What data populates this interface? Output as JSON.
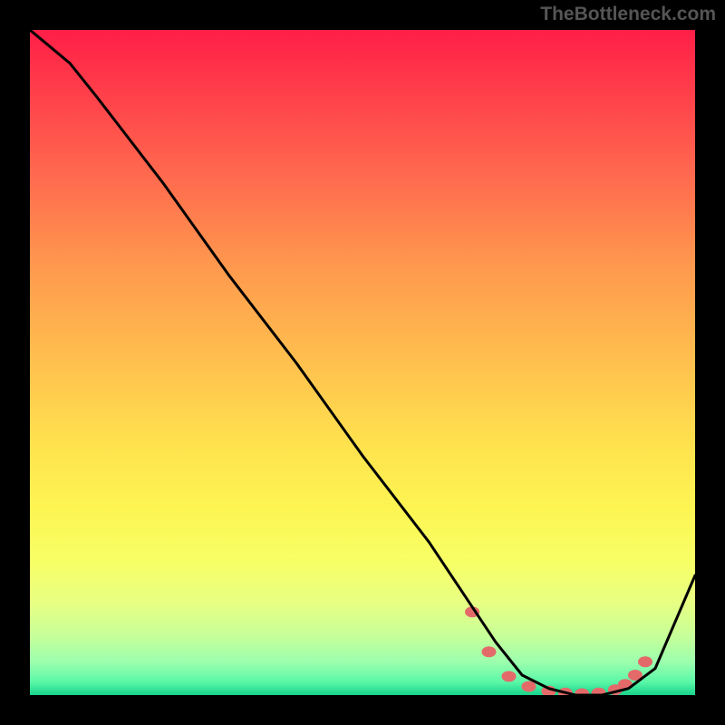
{
  "attribution": "TheBottleneck.com",
  "chart_data": {
    "type": "line",
    "title": "",
    "xlabel": "",
    "ylabel": "",
    "xlim": [
      0,
      100
    ],
    "ylim": [
      0,
      100
    ],
    "x": [
      0,
      6,
      10,
      20,
      30,
      40,
      50,
      60,
      66,
      70,
      74,
      78,
      82,
      86,
      90,
      94,
      100
    ],
    "values": [
      100,
      95,
      90,
      77,
      63,
      50,
      36,
      23,
      14,
      8,
      3,
      1,
      0,
      0,
      1,
      4,
      18
    ],
    "markers": {
      "x": [
        66.5,
        69,
        72,
        75,
        78,
        80.5,
        83,
        85.5,
        88,
        89.5,
        91,
        92.5
      ],
      "values": [
        12.5,
        6.5,
        2.8,
        1.3,
        0.6,
        0.3,
        0.2,
        0.3,
        0.8,
        1.6,
        3.0,
        5.0
      ]
    },
    "colors": {
      "line": "#000000",
      "marker": "#e46a6a",
      "gradient_top": "#ff1e47",
      "gradient_bottom": "#17d38a"
    }
  }
}
